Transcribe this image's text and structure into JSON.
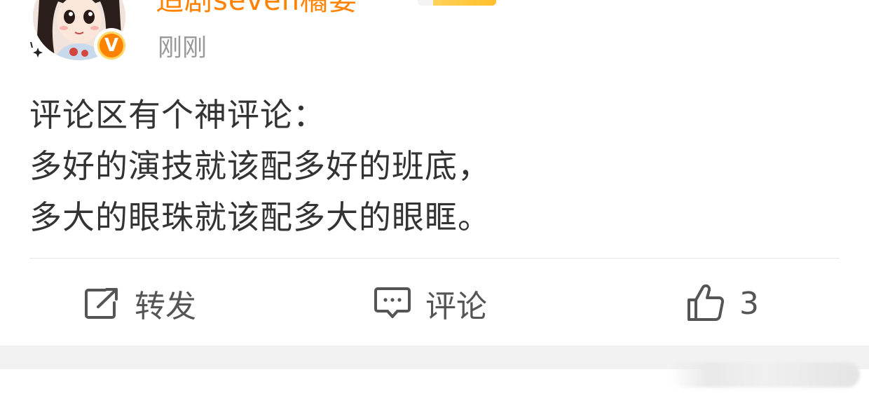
{
  "header": {
    "username": "追剧seven橘要",
    "timestamp": "刚刚",
    "verified_badge": "V",
    "icons": [
      "avatar",
      "verified-badge-icon",
      "sparkle-icon",
      "level-badge",
      "more-icon"
    ]
  },
  "post": {
    "lines": [
      "评论区有个神评论：",
      "多好的演技就该配多好的班底，",
      "多大的眼珠就该配多大的眼眶。"
    ]
  },
  "actions": {
    "repost_label": "转发",
    "comment_label": "评论",
    "like_count": "3"
  },
  "colors": {
    "accent": "#ff8200",
    "text": "#333333",
    "muted": "#999999",
    "separator": "#f2f2f2"
  }
}
